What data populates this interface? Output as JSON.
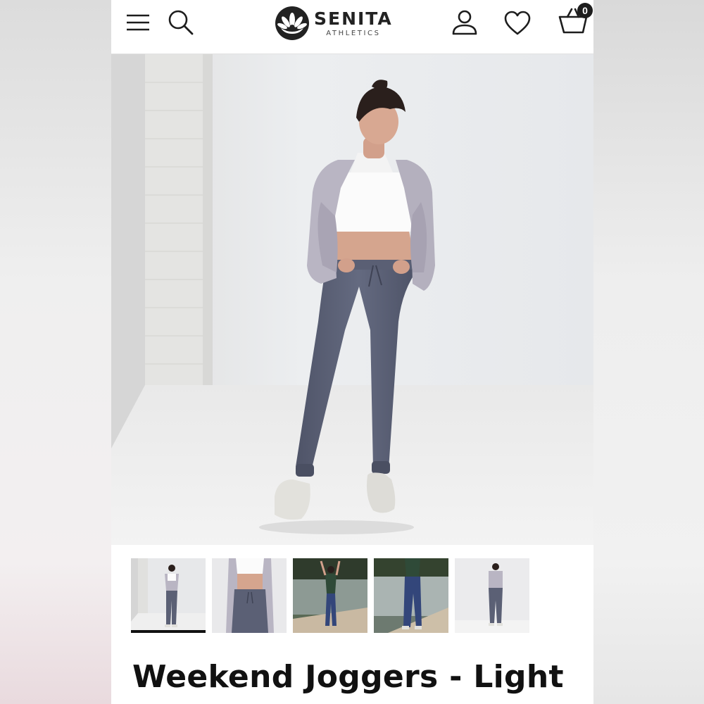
{
  "header": {
    "brand_name": "SENITA",
    "brand_sub": "ATHLETICS",
    "cart_count": "0",
    "menu_icon": "hamburger-menu-icon",
    "search_icon": "search-icon",
    "account_icon": "user-icon",
    "wishlist_icon": "heart-icon",
    "cart_icon": "basket-icon"
  },
  "gallery": {
    "thumbnails": [
      {
        "scene": "studio-full-body",
        "active": true
      },
      {
        "scene": "studio-close-up",
        "active": false
      },
      {
        "scene": "lake-dock-front",
        "active": false
      },
      {
        "scene": "lake-dock-walk",
        "active": false
      },
      {
        "scene": "studio-back-view",
        "active": false
      }
    ]
  },
  "product": {
    "title": "Weekend Joggers - Light"
  },
  "colors": {
    "text": "#111111",
    "jogger": "#5e6378",
    "jacket": "#b8b4c2",
    "background": "#ffffff"
  }
}
